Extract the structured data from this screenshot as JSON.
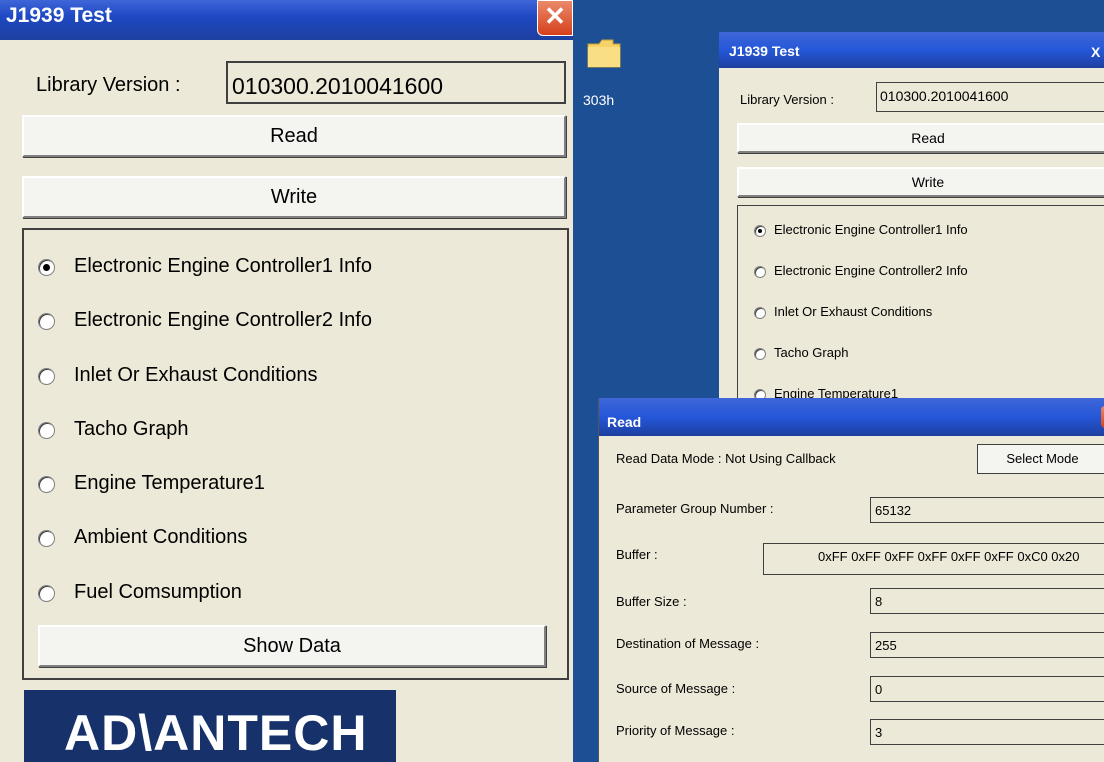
{
  "left_window": {
    "title": "J1939 Test",
    "close_glyph": "✕",
    "library_label": "Library Version :",
    "library_value": "010300.2010041600",
    "read_label": "Read",
    "write_label": "Write",
    "options": [
      {
        "label": "Electronic Engine Controller1 Info",
        "selected": true
      },
      {
        "label": "Electronic Engine Controller2 Info",
        "selected": false
      },
      {
        "label": "Inlet Or Exhaust Conditions",
        "selected": false
      },
      {
        "label": "Tacho Graph",
        "selected": false
      },
      {
        "label": "Engine Temperature1",
        "selected": false
      },
      {
        "label": "Ambient Conditions",
        "selected": false
      },
      {
        "label": "Fuel Comsumption",
        "selected": false
      }
    ],
    "show_data_label": "Show Data",
    "logo_text": "AD\\ANTECH"
  },
  "desktop": {
    "folder_icon": "folder-icon",
    "folder_label": "303h",
    "colors": {
      "background": "#1d4f94",
      "titlebar": "#2457d8",
      "window": "#ece9d8"
    }
  },
  "back_window": {
    "title": "J1939 Test",
    "close_glyph": "X",
    "library_label": "Library Version :",
    "library_value": "010300.2010041600",
    "read_label": "Read",
    "write_label": "Write",
    "options": [
      {
        "label": "Electronic Engine Controller1 Info",
        "selected": true
      },
      {
        "label": "Electronic Engine Controller2 Info",
        "selected": false
      },
      {
        "label": "Inlet Or Exhaust Conditions",
        "selected": false
      },
      {
        "label": "Tacho Graph",
        "selected": false
      },
      {
        "label": "Engine Temperature1",
        "selected": false
      }
    ]
  },
  "read_window": {
    "title": "Read",
    "mode_text": "Read Data Mode : Not Using Callback",
    "select_mode_label": "Select Mode",
    "pgn_label": "Parameter Group Number :",
    "pgn_value": "65132",
    "buffer_label": "Buffer :",
    "buffer_value": "0xFF 0xFF 0xFF 0xFF 0xFF 0xFF 0xC0 0x20",
    "buffer_size_label": "Buffer Size :",
    "buffer_size_value": "8",
    "destination_label": "Destination of Message :",
    "destination_value": "255",
    "source_label": "Source of Message :",
    "source_value": "0",
    "priority_label": "Priority of Message :",
    "priority_value": "3"
  }
}
